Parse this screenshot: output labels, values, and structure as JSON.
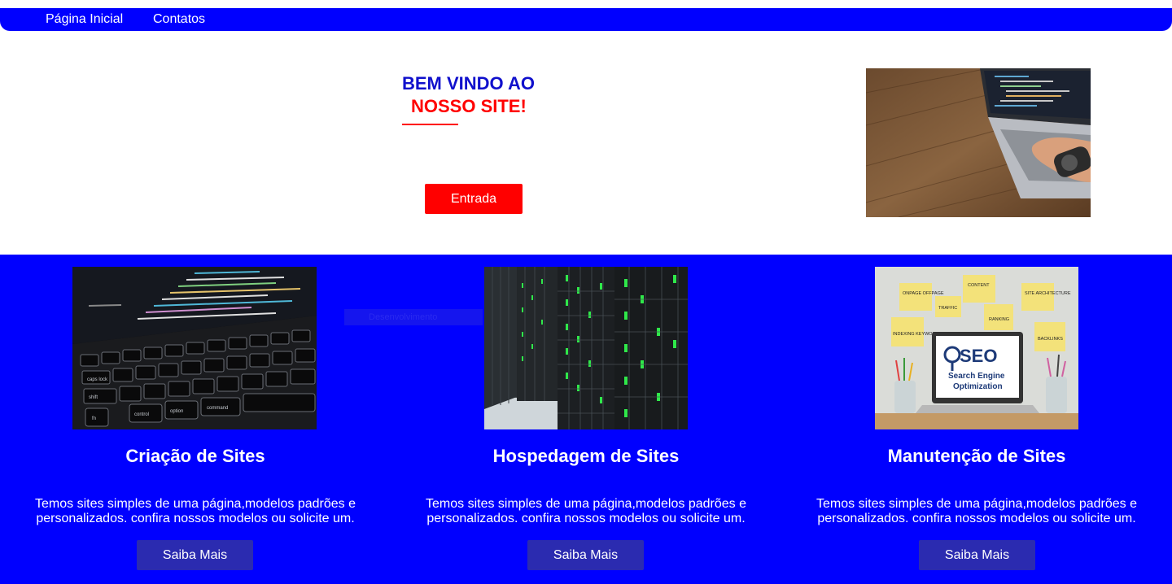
{
  "nav": {
    "home": "Página Inicial",
    "contacts": "Contatos"
  },
  "hero": {
    "title_line1": "BEM VINDO AO",
    "title_line2": "NOSSO SITE!",
    "button": "Entrada",
    "image": "laptop-typing-photo"
  },
  "services": {
    "overlay_text": "Desenvolvimento",
    "cards": [
      {
        "title": "Criação de Sites",
        "description": "Temos sites simples de uma página,modelos padrões e personalizados. confira nossos modelos ou solicite um.",
        "button": "Saiba Mais",
        "image": "keyboard-code-photo",
        "image_keys": [
          "control",
          "option",
          "command",
          "shift",
          "fn",
          "caps lock"
        ]
      },
      {
        "title": "Hospedagem de Sites",
        "description": "Temos sites simples de uma página,modelos padrões e personalizados. confira nossos modelos ou solicite um.",
        "button": "Saiba Mais",
        "image": "server-rack-photo"
      },
      {
        "title": "Manutenção de Sites",
        "description": "Temos sites simples de uma página,modelos padrões e personalizados. confira nossos modelos ou solicite um.",
        "button": "Saiba Mais",
        "image": "seo-laptop-photo",
        "image_notes": [
          "ONPAGE OFFPAGE",
          "CONTENT",
          "SITE ARCHITECTURE",
          "TRAFFIC",
          "RANKING",
          "INDEXING KEYWORDS",
          "BACKLINKS"
        ],
        "image_screen_title": "SEO",
        "image_screen_sub1": "Search Engine",
        "image_screen_sub2": "Optimization"
      }
    ]
  },
  "colors": {
    "primary": "#0000ff",
    "accent": "#ff0000",
    "secondary_button": "#2b2bb0",
    "title_blue": "#1010cc"
  }
}
